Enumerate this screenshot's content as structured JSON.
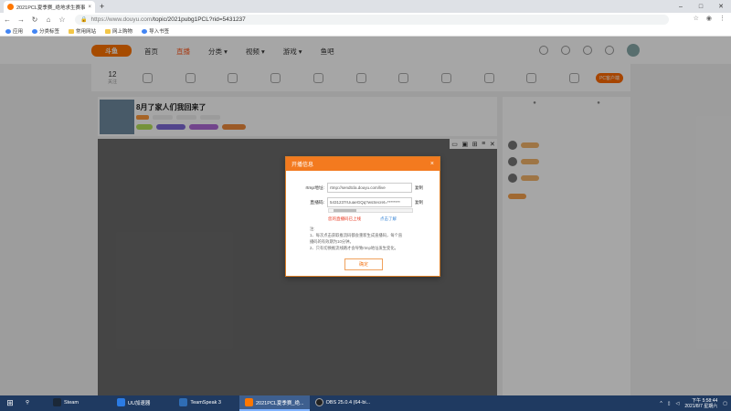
{
  "browser": {
    "tab_title": "2021PCL夏季赛_绝地求生赛事",
    "tab_close": "×",
    "new_tab": "+",
    "url_host": "https://www.douyu.com",
    "url_path": "/topic/2021pubg1PCL?rid=5431237",
    "controls": {
      "minimize": "–",
      "maximize": "□",
      "close": "✕"
    }
  },
  "bookmarks": [
    "应用",
    "分类标签",
    "常用网站",
    "网上购物",
    "导入书签"
  ],
  "site": {
    "logo": "斗鱼",
    "nav": [
      {
        "label": "首页",
        "active": false
      },
      {
        "label": "直播",
        "active": true
      },
      {
        "label": "分类 ▾",
        "active": false
      },
      {
        "label": "视频 ▾",
        "active": false
      },
      {
        "label": "游戏 ▾",
        "active": false
      },
      {
        "label": "鱼吧",
        "active": false
      }
    ]
  },
  "category_bar": {
    "count": "12",
    "count_label": "关注",
    "pc_button": "PC客户端"
  },
  "room": {
    "title": "8月了家人们我回来了"
  },
  "dialog": {
    "title": "开播信息",
    "close": "×",
    "rtmp_label": "rtmp地址:",
    "rtmp_value": "rtmp://sendtcla.douyu.com/live",
    "key_label": "直播码:",
    "key_value": "5431237rUuaeGQq?wsSecret=********",
    "copy": "复制",
    "warning": "您的直播码已上线",
    "help_link": "点击了解",
    "notes": [
      "注:",
      "1、每次点击获取推流码都会重新生成直播码，每个直",
      "播码的有效期为10分钟。",
      "2、只有切换推流线路才会导致rtmp地址发生变化。"
    ],
    "ok_button": "确定"
  },
  "taskbar": {
    "start": "⊞",
    "items": [
      {
        "label": "Steam",
        "color": "#1b2838",
        "active": false
      },
      {
        "label": "UU加速器",
        "color": "#2b7be4",
        "active": false
      },
      {
        "label": "TeamSpeak 3",
        "color": "#2f6db5",
        "active": false
      },
      {
        "label": "2021PCL夏季赛_绝...",
        "color": "#ff7700",
        "active": true
      },
      {
        "label": "OBS 25.0.4 (64-bi...",
        "color": "#222222",
        "active": false
      }
    ],
    "time": "5:58:44",
    "ampm": "下午",
    "date": "2021/8/7 星期六"
  }
}
